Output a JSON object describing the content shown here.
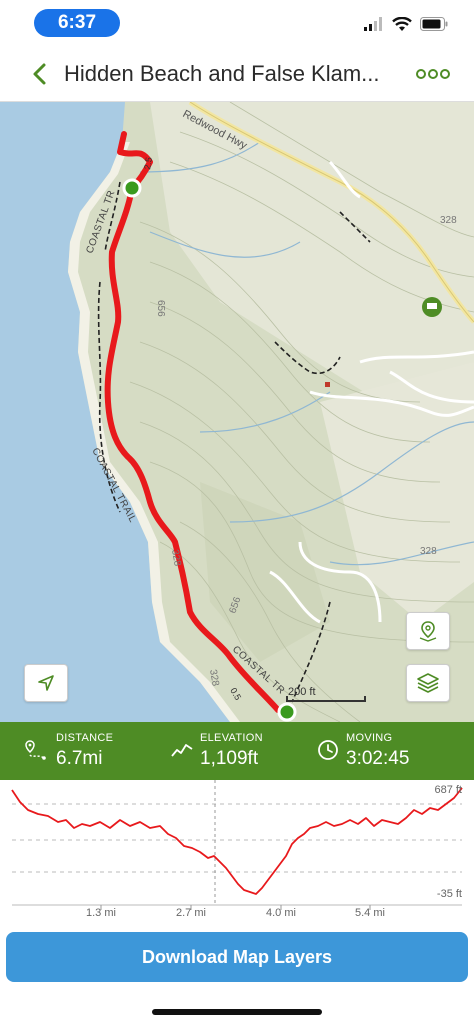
{
  "status_bar": {
    "time": "6:37"
  },
  "header": {
    "title": "Hidden Beach and False Klam..."
  },
  "map": {
    "labels": {
      "highway": "Redwood Hwy",
      "trail_north": "COASTAL TR",
      "trail_mid": "COASTAL TRAIL",
      "trail_south": "COASTAL TR",
      "contour_656a": "656",
      "contour_656b": "656",
      "contour_328a": "328",
      "contour_328b": "328",
      "contour_328c": "328",
      "contour_328d": "328",
      "mile_marker_25": "2.5",
      "mile_marker_05": "0.5"
    },
    "scale": "200 ft",
    "colors": {
      "water": "#a9cbe3",
      "land": "#d6dcc4",
      "trail": "#e8191c",
      "route_marker": "#3a9a1e"
    }
  },
  "stats": {
    "distance": {
      "label": "DISTANCE",
      "value": "6.7mi"
    },
    "elevation": {
      "label": "ELEVATION",
      "value": "1,109ft"
    },
    "moving": {
      "label": "MOVING",
      "value": "3:02:45"
    }
  },
  "elevation_chart": {
    "max_label": "687 ft",
    "min_label": "-35 ft",
    "x_ticks": [
      "1.3 mi",
      "2.7 mi",
      "4.0 mi",
      "5.4 mi"
    ]
  },
  "download_button": {
    "label": "Download Map Layers"
  }
}
